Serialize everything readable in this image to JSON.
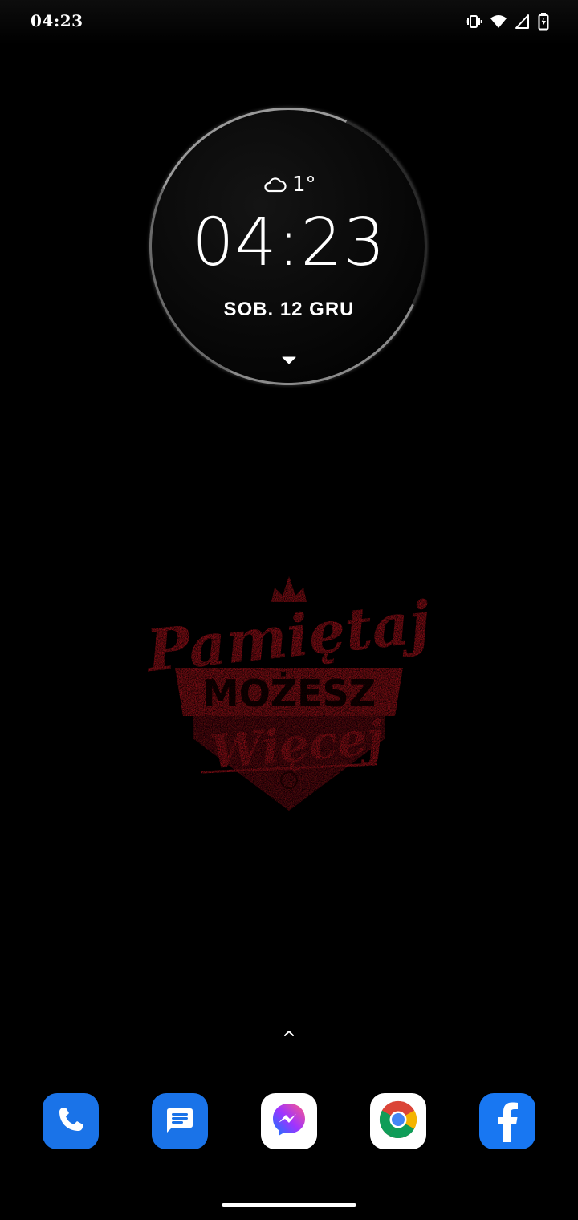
{
  "status_bar": {
    "time": "04:23",
    "icons": [
      "vibrate-icon",
      "wifi-icon",
      "cell-signal-icon",
      "battery-charging-icon"
    ]
  },
  "clock_widget": {
    "weather_icon": "partly-cloudy-night-icon",
    "temperature": "1°",
    "time": "04:23",
    "date": "SOB. 12 GRU",
    "expand_icon": "caret-down-icon"
  },
  "wallpaper": {
    "text_top": "Pamiętaj",
    "text_middle": "MOŻESZ",
    "text_bottom": "Więcej",
    "accent_color": "#b0121c"
  },
  "app_drawer_hint": {
    "icon": "chevron-up-icon"
  },
  "dock": {
    "apps": [
      {
        "name": "Phone",
        "icon": "phone-icon",
        "color": "#1a73e8"
      },
      {
        "name": "Messages",
        "icon": "messages-icon",
        "color": "#1a73e8"
      },
      {
        "name": "Messenger",
        "icon": "messenger-icon",
        "color": "#ffffff"
      },
      {
        "name": "Chrome",
        "icon": "chrome-icon",
        "color": "#ffffff"
      },
      {
        "name": "Facebook",
        "icon": "facebook-icon",
        "color": "#1877f2"
      }
    ]
  }
}
